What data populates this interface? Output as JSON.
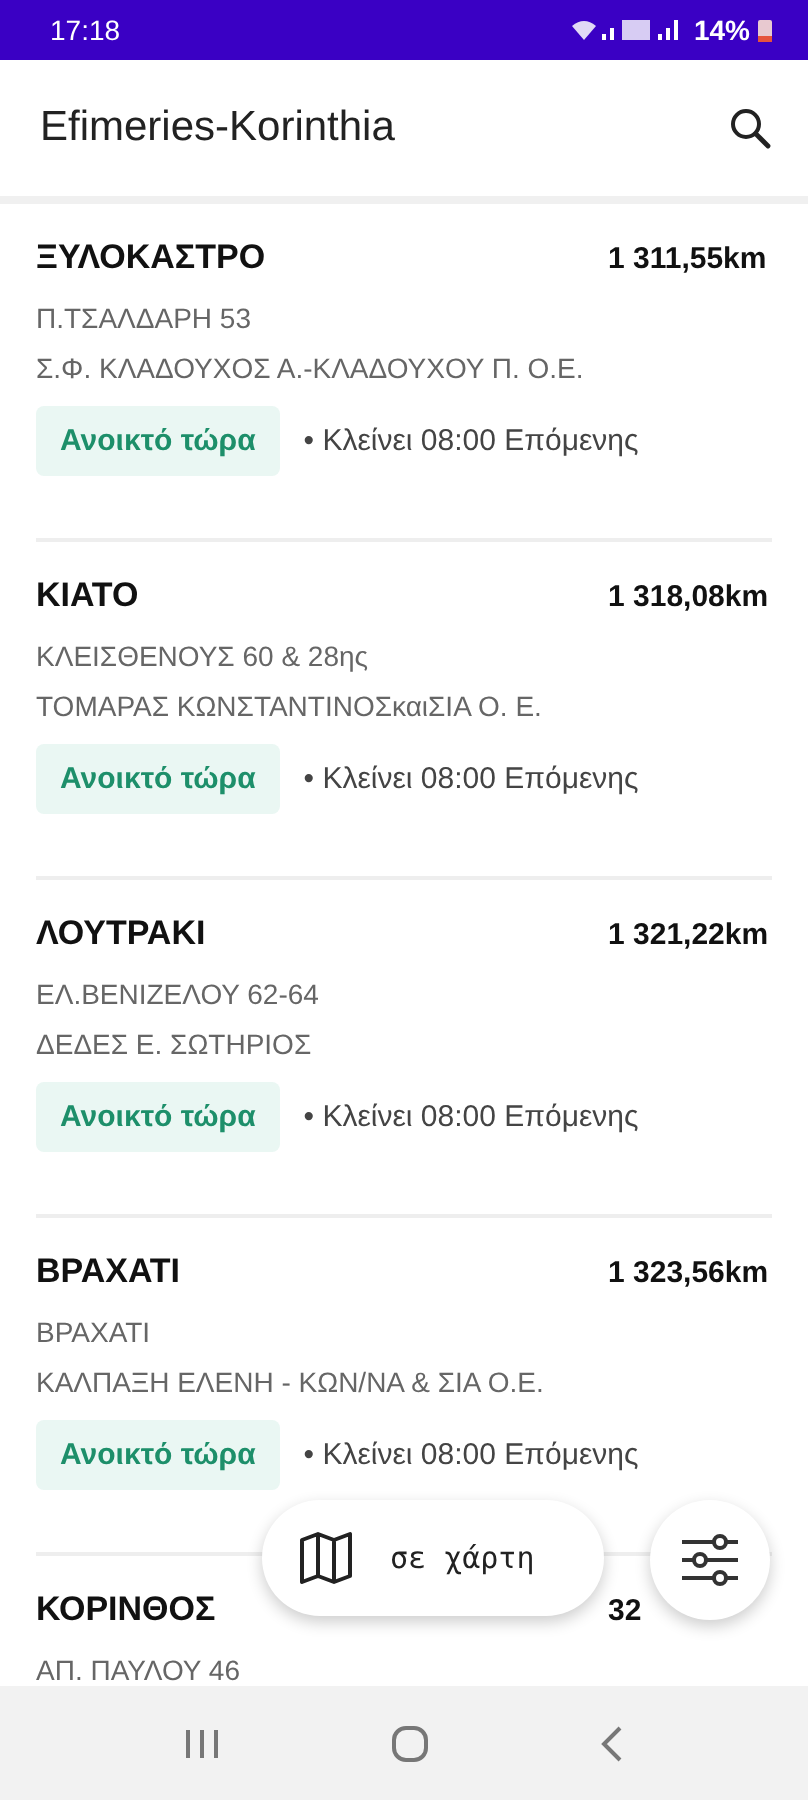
{
  "status_bar": {
    "time": "17:18",
    "battery": "14%"
  },
  "app_bar": {
    "title": "Efimeries-Korinthia"
  },
  "pharmacies": [
    {
      "name": "ΞΥΛΟΚΑΣΤΡΟ",
      "distance": "1 311,55km",
      "address": "Π.ΤΣΑΛΔΑΡΗ 53",
      "owner": "Σ.Φ. ΚΛΑΔΟΥΧΟΣ Α.-ΚΛΑΔΟΥΧΟΥ Π. Ο.Ε.",
      "open": true,
      "status": "Ανοικτό τώρα",
      "hours": "• Κλείνει 08:00 Επόμενης"
    },
    {
      "name": "ΚΙΑΤΟ",
      "distance": "1 318,08km",
      "address": "ΚΛΕΙΣΘΕΝΟΥΣ 60 & 28ης",
      "owner": "ΤΟΜΑΡΑΣ ΚΩΝΣΤΑΝΤΙΝΟΣκαιΣΙΑ Ο. Ε.",
      "open": true,
      "status": "Ανοικτό τώρα",
      "hours": "• Κλείνει 08:00 Επόμενης"
    },
    {
      "name": "ΛΟΥΤΡΑΚΙ",
      "distance": "1 321,22km",
      "address": "ΕΛ.ΒΕΝΙΖΕΛΟΥ 62-64",
      "owner": "ΔΕΔΕΣ Ε. ΣΩΤΗΡΙΟΣ",
      "open": true,
      "status": "Ανοικτό τώρα",
      "hours": "• Κλείνει 08:00 Επόμενης"
    },
    {
      "name": "ΒΡΑΧΑΤΙ",
      "distance": "1 323,56km",
      "address": "ΒΡΑΧΑΤΙ",
      "owner": "ΚΑΛΠΑΞΗ ΕΛΕΝΗ - ΚΩΝ/ΝΑ & ΣΙΑ Ο.Ε.",
      "open": true,
      "status": "Ανοικτό τώρα",
      "hours": "• Κλείνει 08:00 Επόμενης"
    },
    {
      "name": "ΚΟΡΙΝΘΟΣ",
      "distance": "32",
      "address": "ΑΠ. ΠΑΥΛΟΥ 46"
    }
  ],
  "map_button": {
    "label": "σε χάρτη"
  }
}
